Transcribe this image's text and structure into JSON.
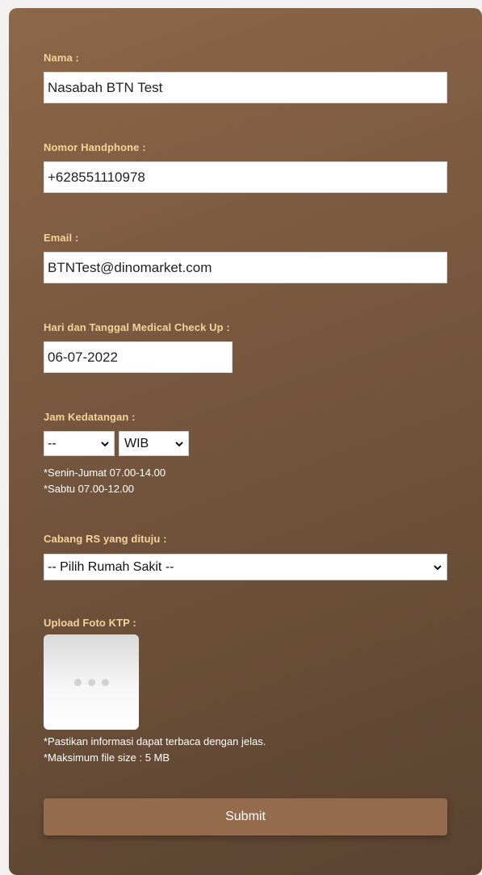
{
  "form": {
    "nama": {
      "label": "Nama :",
      "value": "Nasabah BTN Test"
    },
    "phone": {
      "label": "Nomor Handphone :",
      "value": "+628551110978"
    },
    "email": {
      "label": "Email :",
      "value": "BTNTest@dinomarket.com"
    },
    "date": {
      "label": "Hari dan Tanggal Medical Check Up :",
      "value": "06-07-2022"
    },
    "jam": {
      "label": "Jam Kedatangan :",
      "hour_value": "--",
      "zone_value": "WIB",
      "note1": "*Senin-Jumat 07.00-14.00",
      "note2": "*Sabtu 07.00-12.00"
    },
    "rs": {
      "label": "Cabang RS yang dituju :",
      "value": "-- Pilih Rumah Sakit --"
    },
    "upload": {
      "label": "Upload Foto KTP :",
      "note1": "*Pastikan informasi dapat terbaca dengan jelas.",
      "note2": "*Maksimum file size : 5 MB"
    },
    "submit_label": "Submit"
  },
  "colors": {
    "label": "#f3d39a",
    "button": "#946b4d",
    "card_top": "#8d6749",
    "card_bottom": "#5a432f"
  }
}
